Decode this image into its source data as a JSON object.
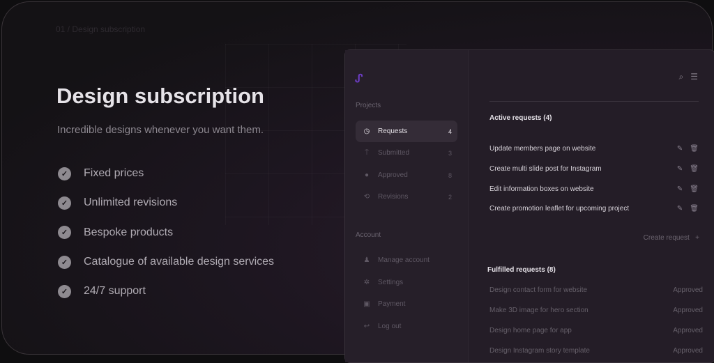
{
  "breadcrumb": "01 / Design subscription",
  "title": "Design subscription",
  "subtitle": "Incredible designs whenever you want them.",
  "features": [
    "Fixed prices",
    "Unlimited revisions",
    "Bespoke products",
    "Catalogue of available design services",
    "24/7 support"
  ],
  "sidebar": {
    "projects_label": "Projects",
    "projects": [
      {
        "label": "Requests",
        "count": "4",
        "icon": "clock-icon"
      },
      {
        "label": "Submitted",
        "count": "3",
        "icon": "pin-icon"
      },
      {
        "label": "Approved",
        "count": "8",
        "icon": "check-circle-icon"
      },
      {
        "label": "Revisions",
        "count": "2",
        "icon": "repeat-icon"
      }
    ],
    "account_label": "Account",
    "account": [
      {
        "label": "Manage account",
        "icon": "user-icon"
      },
      {
        "label": "Settings",
        "icon": "gear-icon"
      },
      {
        "label": "Payment",
        "icon": "card-icon"
      },
      {
        "label": "Log out",
        "icon": "logout-icon"
      }
    ]
  },
  "active": {
    "title": "Active requests (4)",
    "items": [
      "Update members page on website",
      "Create multi slide post for Instagram",
      "Edit information boxes on website",
      "Create promotion leaflet for upcoming project"
    ]
  },
  "create_label": "Create request",
  "fulfilled": {
    "title": "Fulfilled requests (8)",
    "items": [
      {
        "name": "Design contact form for website",
        "status": "Approved"
      },
      {
        "name": "Make 3D image for hero section",
        "status": "Approved"
      },
      {
        "name": "Design home page for app",
        "status": "Approved"
      },
      {
        "name": "Design Instagram story template",
        "status": "Approved"
      }
    ]
  },
  "colors": {
    "accent": "#6b3cc0"
  }
}
